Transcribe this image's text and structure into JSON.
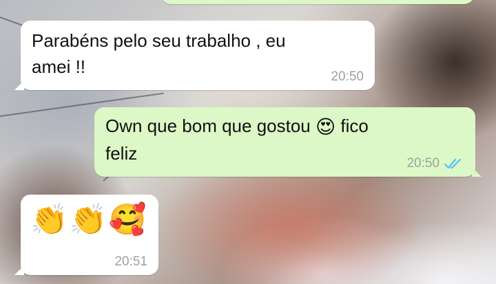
{
  "messages": [
    {
      "direction": "incoming",
      "text": "Parabéns pelo seu trabalho , eu\namei !!",
      "time": "20:50"
    },
    {
      "direction": "outgoing",
      "text_before": "Own que bom que gostou ",
      "emoji": "😍",
      "text_after": " fico\nfeliz",
      "time": "20:50",
      "status": "read"
    },
    {
      "direction": "incoming",
      "emoji": "👏👏🥰",
      "time": "20:51"
    }
  ],
  "colors": {
    "incoming_bubble": "#ffffff",
    "outgoing_bubble": "#dcf8c6",
    "read_ticks": "#4fc3f7",
    "timestamp": "#9aa3a0"
  },
  "icons": {
    "read_status": "double-check-icon"
  }
}
